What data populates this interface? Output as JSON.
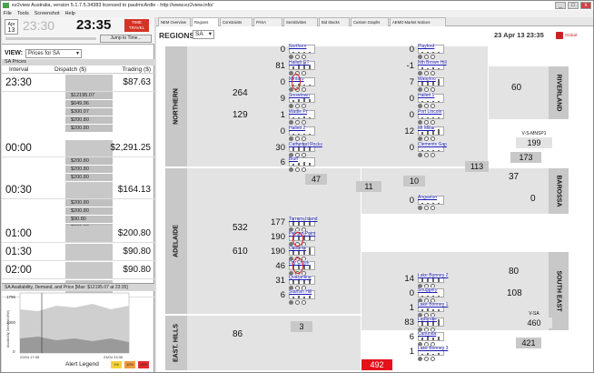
{
  "window": {
    "title": "ez2view Australia, version 5.1.7.5.34383 licensed to paulmcArdle - http://www.ez2view.info/"
  },
  "menu": [
    "File",
    "Tools",
    "Screenshot",
    "Help"
  ],
  "timebar": {
    "cal_month": "Apr",
    "cal_day": "13",
    "prev_time": "23:30",
    "time": "23:35",
    "badge": "TIME TRAVEL",
    "jump": "Jump to Time..."
  },
  "view": {
    "label": "VIEW:",
    "value": "Prices for SA"
  },
  "prices_panel": {
    "title": "SA Prices",
    "col_interval": "Interval",
    "col_dispatch": "Dispatch ($)",
    "col_trading": "Trading ($)",
    "rows": [
      {
        "interval": "23:30",
        "trading": "$87.63",
        "dispatch": [
          "$12195.07",
          "$649.96",
          "$300.07",
          "$200.80",
          "$200.80"
        ]
      },
      {
        "interval": "00:00",
        "trading": "$2,291.25",
        "dispatch": [
          "$200.80",
          "$200.80",
          "$200.80",
          "$200.80",
          "$200.80"
        ]
      },
      {
        "interval": "00:30",
        "trading": "$164.13",
        "dispatch": [
          "$200.80",
          "$200.80",
          "$90.80",
          "$200.80"
        ]
      },
      {
        "interval": "01:00",
        "trading": "$200.80",
        "dispatch": []
      },
      {
        "interval": "01:30",
        "trading": "$90.80",
        "dispatch": []
      },
      {
        "interval": "02:00",
        "trading": "$90.80",
        "dispatch": []
      },
      {
        "interval": "02:30",
        "trading": "$90.80",
        "dispatch": []
      }
    ]
  },
  "sa_chart": {
    "title": "SA Availability, Demand, and Price [Max: $12195.07 at 23:35]",
    "ylabel": "Availability, Demand (MW)",
    "y_ticks": [
      "1796",
      "1000",
      "0"
    ],
    "x_ticks": [
      "22/04 17:35",
      "23/04 23:35"
    ],
    "alert_legend": "Alert Legend",
    "alert_levels": [
      {
        "label": "1%",
        "color": "#f5d23b"
      },
      {
        "label": "10%",
        "color": "#f19a3a"
      },
      {
        "label": "15%",
        "color": "#e02c2c"
      }
    ]
  },
  "chart_data": {
    "type": "area",
    "title": "SA Availability, Demand, and Price [Max: $12195.07 at 23:35]",
    "ylabel": "Availability, Demand (MW)",
    "ylim": [
      0,
      1796
    ],
    "x": [
      "22/04 17:35",
      "23/04 23:35"
    ],
    "series": []
  },
  "tabs": [
    "NEM Overview",
    "Regions",
    "Constraints",
    "PASA",
    "Sensitivities",
    "Bid Stacks",
    "Custom Graphs",
    "AEMO Market Notices"
  ],
  "active_tab": "Regions",
  "regions_header": {
    "label": "REGIONS:",
    "value": "SA",
    "date": "23 Apr 13 23:35",
    "logo": "Global-Roam"
  },
  "regions": [
    {
      "name": "NORTHERN",
      "gen": "264",
      "load": "129"
    },
    {
      "name": "ADELAIDE",
      "gen": "532",
      "load": "610"
    },
    {
      "name": "EAST. HILLS",
      "gen": "86"
    },
    {
      "name": "RIVERLAND",
      "gen": "60"
    },
    {
      "name": "BAROSSA",
      "gen": "37",
      "load": "0"
    },
    {
      "name": "SOUTH EAST",
      "gen": "80",
      "load": "108"
    }
  ],
  "generators": [
    {
      "name": "Northern",
      "mw": "0"
    },
    {
      "name": "Hallett GT",
      "mw": "81"
    },
    {
      "name": "Mintaro",
      "mw": "0"
    },
    {
      "name": "Snowtown",
      "mw": "9"
    },
    {
      "name": "Wattle Pt",
      "mw": "1"
    },
    {
      "name": "Hallett 2",
      "mw": "0"
    },
    {
      "name": "Cathedral Rocks",
      "mw": "30"
    },
    {
      "name": "Bluff",
      "mw": "6"
    },
    {
      "name": "Playford",
      "mw": "0"
    },
    {
      "name": "Nth Brown Hill",
      "mw": "-1"
    },
    {
      "name": "Waterloo",
      "mw": "7"
    },
    {
      "name": "Hallett 1",
      "mw": "0"
    },
    {
      "name": "Port Lincoln",
      "mw": "0"
    },
    {
      "name": "Mt Millar",
      "mw": "12"
    },
    {
      "name": "Clements Gap",
      "mw": "0"
    },
    {
      "name": "Angaston",
      "mw": "0"
    },
    {
      "name": "Torrens Island",
      "mw": "177"
    },
    {
      "name": "Pelican Point",
      "mw": "190"
    },
    {
      "name": "Osborne",
      "mw": "190"
    },
    {
      "name": "Dry Creek",
      "mw": "46"
    },
    {
      "name": "Quarantine",
      "mw": "31"
    },
    {
      "name": "Starfish Hill",
      "mw": "6"
    },
    {
      "name": "Lake Bonney 2",
      "mw": "14"
    },
    {
      "name": "Snuggery",
      "mw": "0"
    },
    {
      "name": "Lake Bonney 1",
      "mw": "1"
    },
    {
      "name": "Ladbroke",
      "mw": "83"
    },
    {
      "name": "Canunda",
      "mw": "6"
    },
    {
      "name": "Lake Bonney 3",
      "mw": "1"
    }
  ],
  "flows": {
    "north_adel": "47",
    "north_riv": "113",
    "adel_north": "11",
    "baro_adel": "10",
    "adel_eh": "3",
    "vic_sa": "492",
    "riv_rv": "173"
  },
  "interconnectors": [
    {
      "name": "V-S-MNSP1",
      "mw": "199"
    },
    {
      "name": "V-SA",
      "mw": "460",
      "extra": "421"
    }
  ]
}
